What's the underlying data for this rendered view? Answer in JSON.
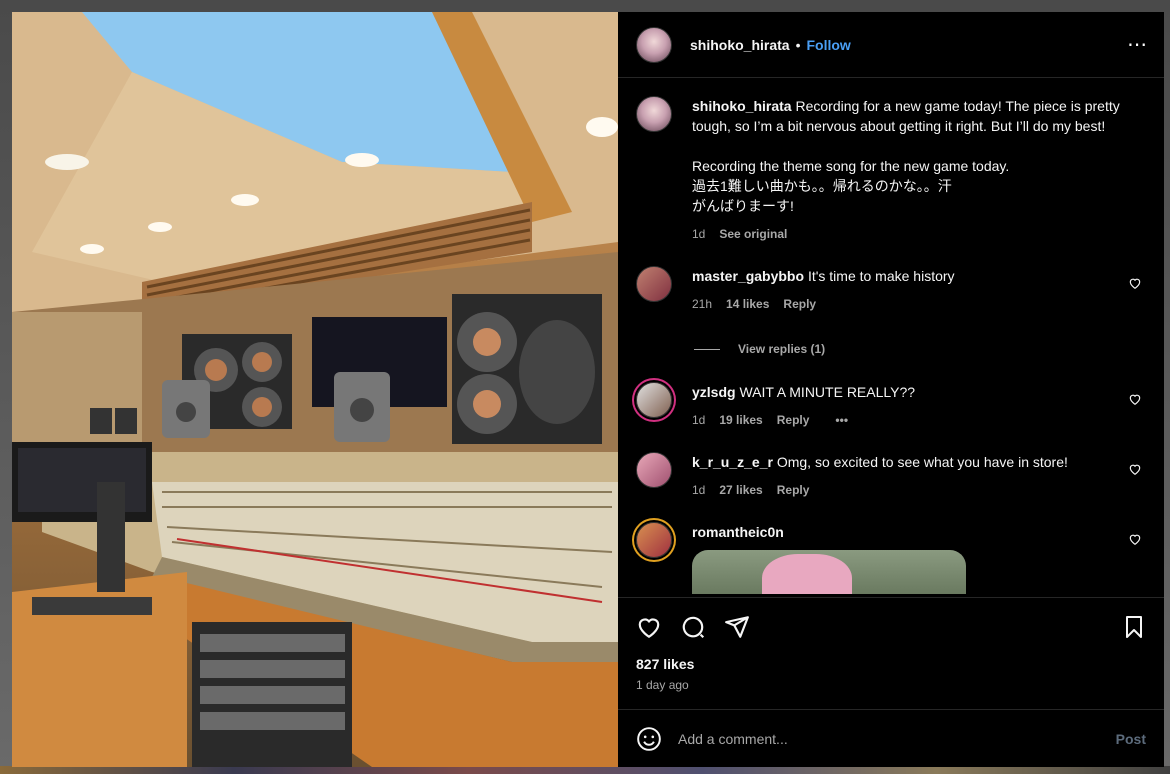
{
  "post": {
    "username": "shihoko_hirata",
    "dot": "•",
    "follow_label": "Follow",
    "more_icon": "⋯"
  },
  "caption": {
    "username": "shihoko_hirata",
    "text": "Recording for a new game today! The piece is pretty tough, so I’m a bit nervous about getting it right. But I’ll do my best!\n\nRecording the theme song for the new game today.\n過去1難しい曲かも。。帰れるのかな。。汗\nがんばりまーす!",
    "time": "1d",
    "see_original": "See original"
  },
  "comments": [
    {
      "username": "master_gabybbo",
      "text": "It's time to make history",
      "time": "21h",
      "likes": "14 likes",
      "reply": "Reply",
      "view_replies": "View replies (1)"
    },
    {
      "username": "yzlsdg",
      "text": "WAIT A MINUTE REALLY??",
      "time": "1d",
      "likes": "19 likes",
      "reply": "Reply",
      "more": "•••"
    },
    {
      "username": "k_r_u_z_e_r",
      "text": "Omg, so excited to see what you have in store!",
      "time": "1d",
      "likes": "27 likes",
      "reply": "Reply"
    },
    {
      "username": "romantheic0n",
      "text": ""
    }
  ],
  "stats": {
    "likes": "827 likes",
    "ago": "1 day ago"
  },
  "add_comment": {
    "placeholder": "Add a comment...",
    "post_label": "Post"
  },
  "colors": {
    "accent": "#4a9ff5",
    "background": "#000000",
    "muted": "#a8a8a8"
  }
}
